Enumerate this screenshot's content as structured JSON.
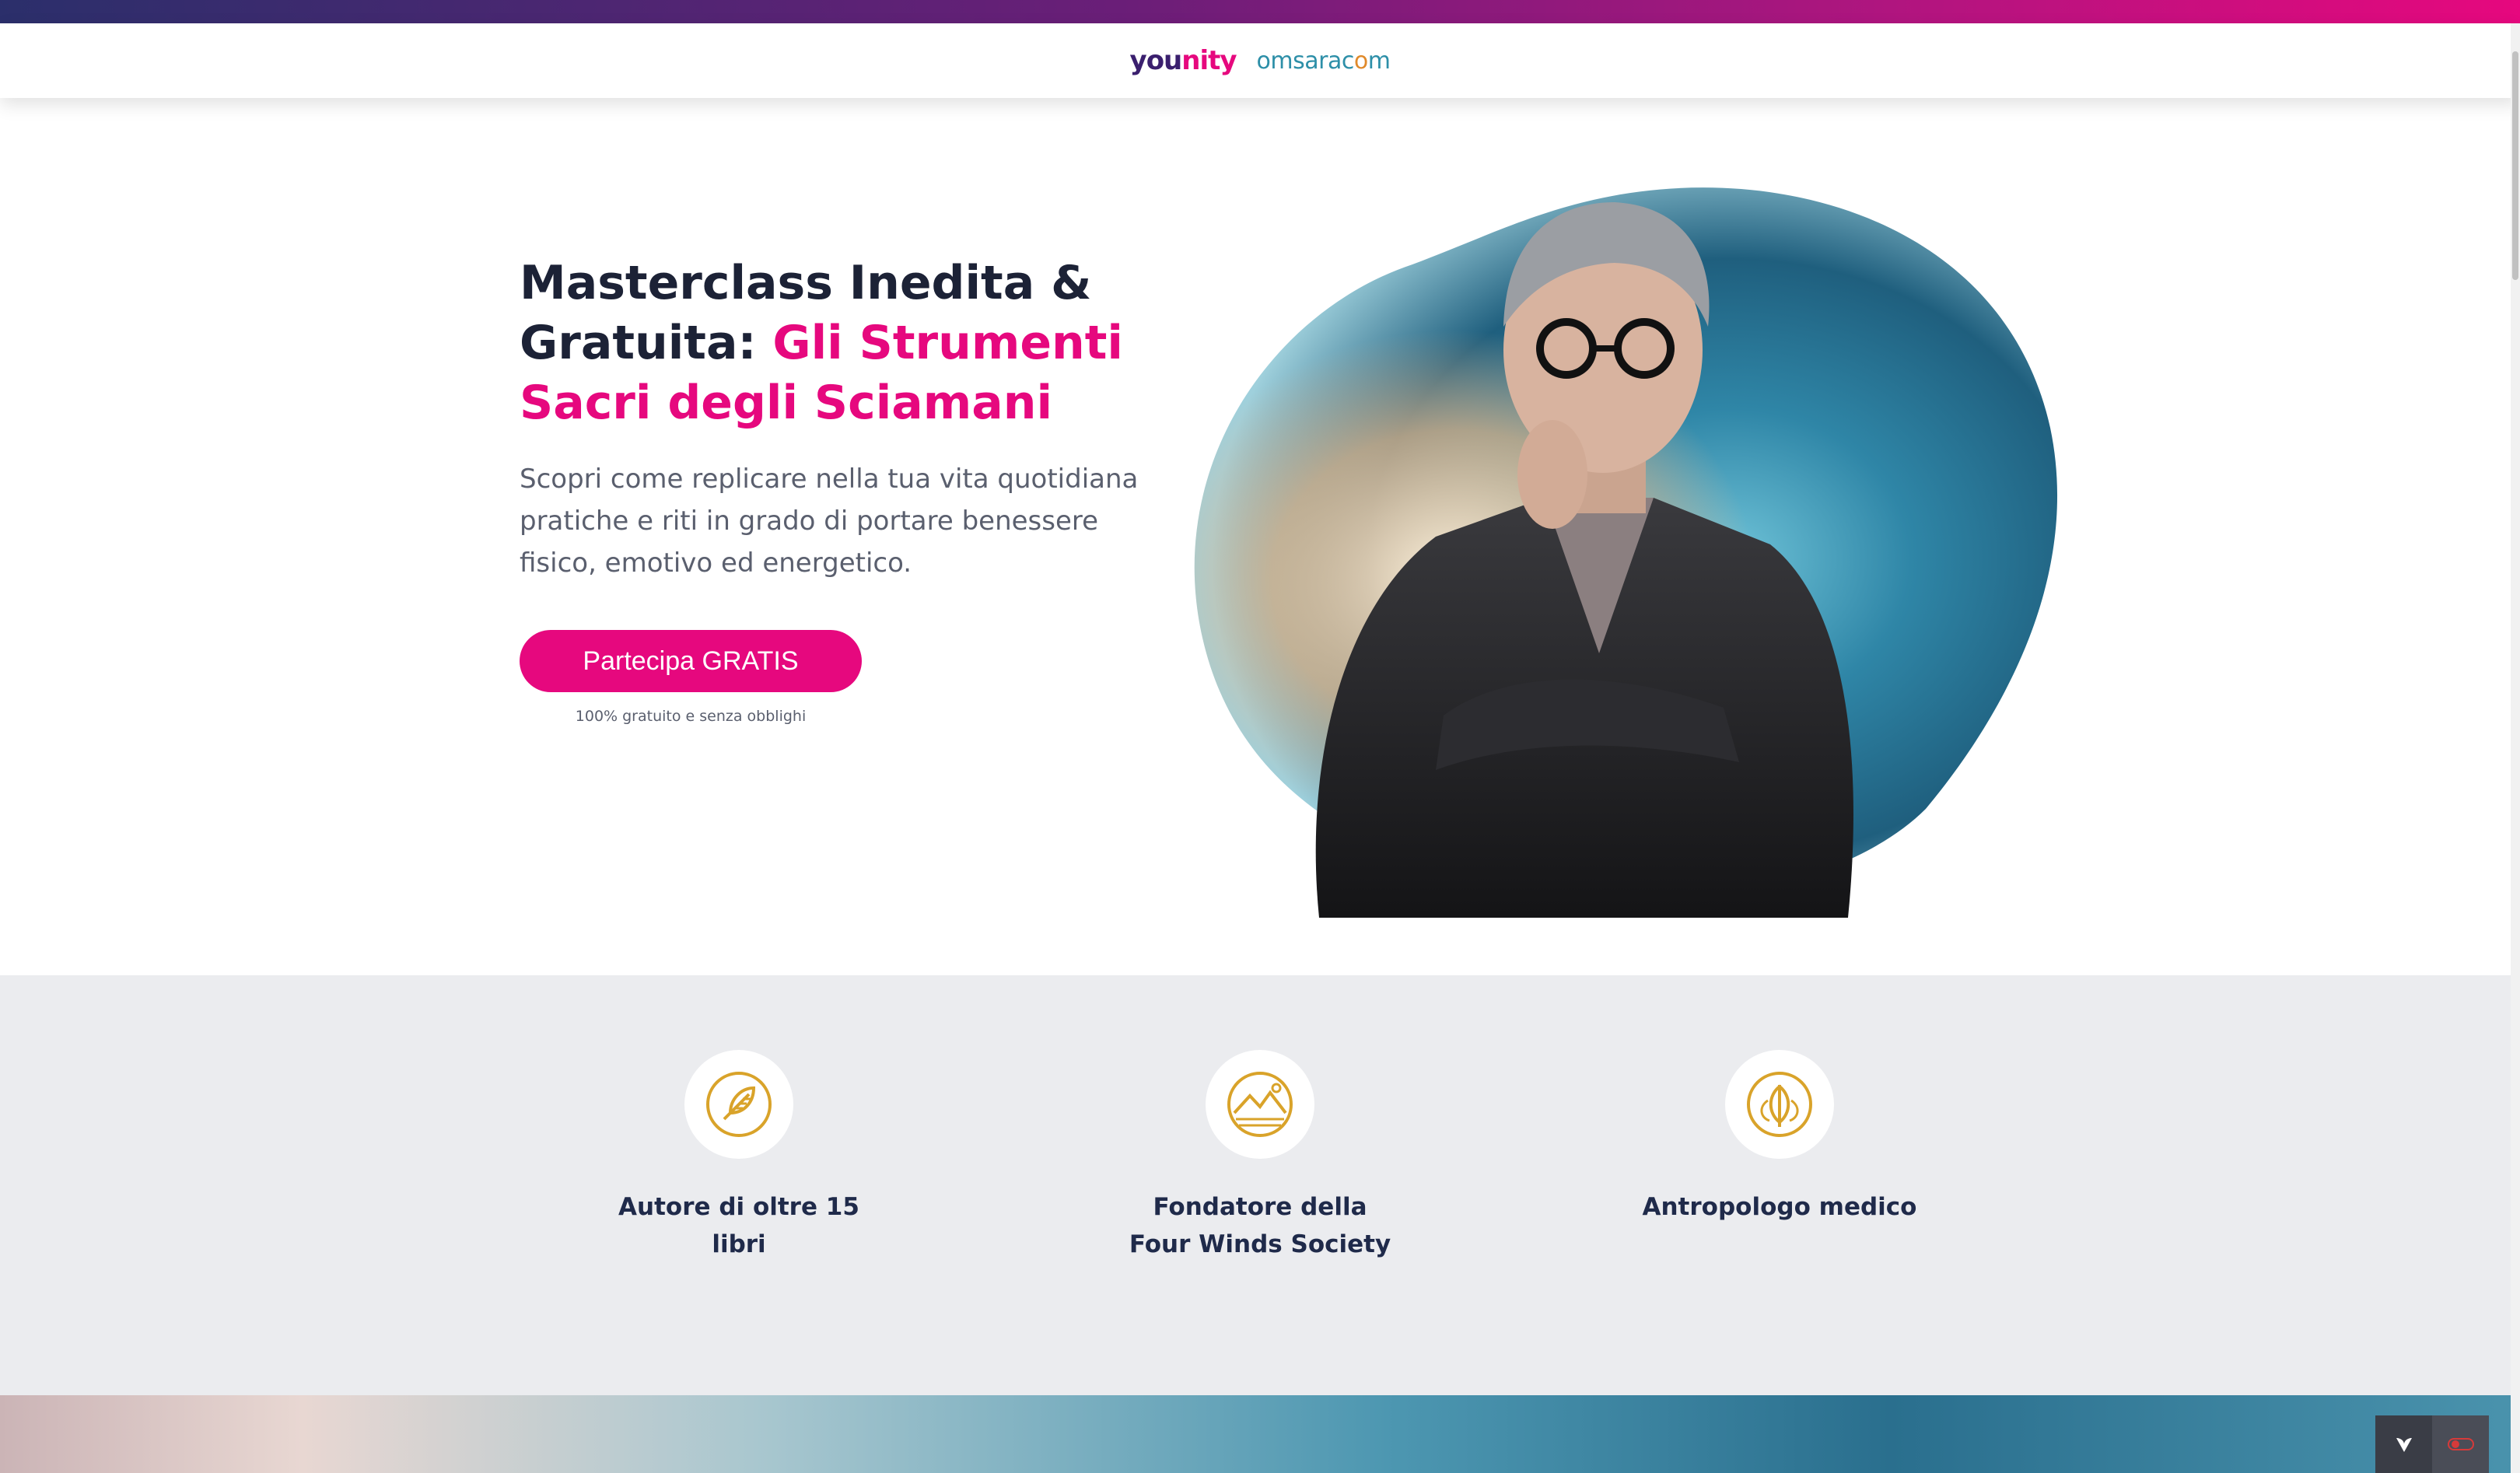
{
  "brand": {
    "younity_prefix": "you",
    "younity_suffix": "nity",
    "omsaracom_prefix": "omsarac",
    "omsaracom_o": "o",
    "omsaracom_suffix": "m",
    "colors": {
      "accent": "#e6087e",
      "navy": "#1c2236",
      "feature_icon": "#d9a32a",
      "section_bg": "#ebecef"
    }
  },
  "hero": {
    "headline_plain": "Masterclass Inedita & Gratuita: ",
    "headline_highlight": "Gli Strumenti Sacri degli Sciamani",
    "subtext": "Scopri come replicare nella tua vita quotidiana pratiche e riti in grado di portare benessere fisico, emotivo ed energetico.",
    "cta_label": "Partecipa GRATIS",
    "cta_note": "100% gratuito e senza obblighi"
  },
  "features": [
    {
      "icon": "feather-icon",
      "label": "Autore di oltre 15 libri"
    },
    {
      "icon": "mountains-icon",
      "label": "Fondatore della Four Winds Society"
    },
    {
      "icon": "leaves-icon",
      "label": "Antropologo medico"
    }
  ],
  "floating_badge": {
    "left_icon": "leaf-logo-icon",
    "right_icon": "toggle-icon"
  }
}
